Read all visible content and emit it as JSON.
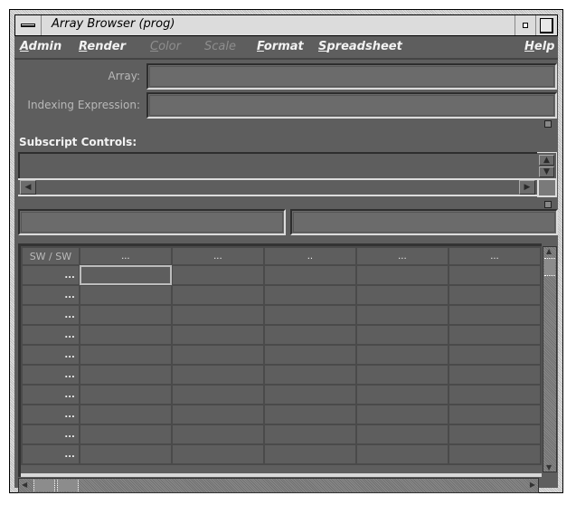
{
  "window": {
    "title": "Array Browser (prog)"
  },
  "menubar": {
    "items": [
      {
        "label": "Admin",
        "mnemonic": "A",
        "rest": "dmin",
        "enabled": true
      },
      {
        "label": "Render",
        "mnemonic": "R",
        "rest": "ender",
        "enabled": true
      },
      {
        "label": "Color",
        "mnemonic": "C",
        "rest": "olor",
        "enabled": false
      },
      {
        "label": "Scale",
        "mnemonic": "S",
        "rest": "cale",
        "enabled": false
      },
      {
        "label": "Format",
        "mnemonic": "F",
        "rest": "ormat",
        "enabled": true
      },
      {
        "label": "Spreadsheet",
        "mnemonic": "S",
        "rest": "preadsheet",
        "enabled": true
      },
      {
        "label": "Help",
        "mnemonic": "H",
        "rest": "elp",
        "enabled": true
      }
    ]
  },
  "form": {
    "array_label": "Array:",
    "array_value": "",
    "indexing_label": "Indexing Expression:",
    "indexing_value": "",
    "subscript_heading": "Subscript Controls:",
    "left_field_value": "",
    "right_field_value": ""
  },
  "grid": {
    "corner_label": "SW / SW",
    "column_headers": [
      "...",
      "...",
      "..",
      "...",
      "..."
    ],
    "row_headers": [
      "...",
      "...",
      "...",
      "...",
      "...",
      "...",
      "...",
      "...",
      "...",
      "..."
    ],
    "selected_cell": {
      "row": 0,
      "col": 0
    }
  }
}
